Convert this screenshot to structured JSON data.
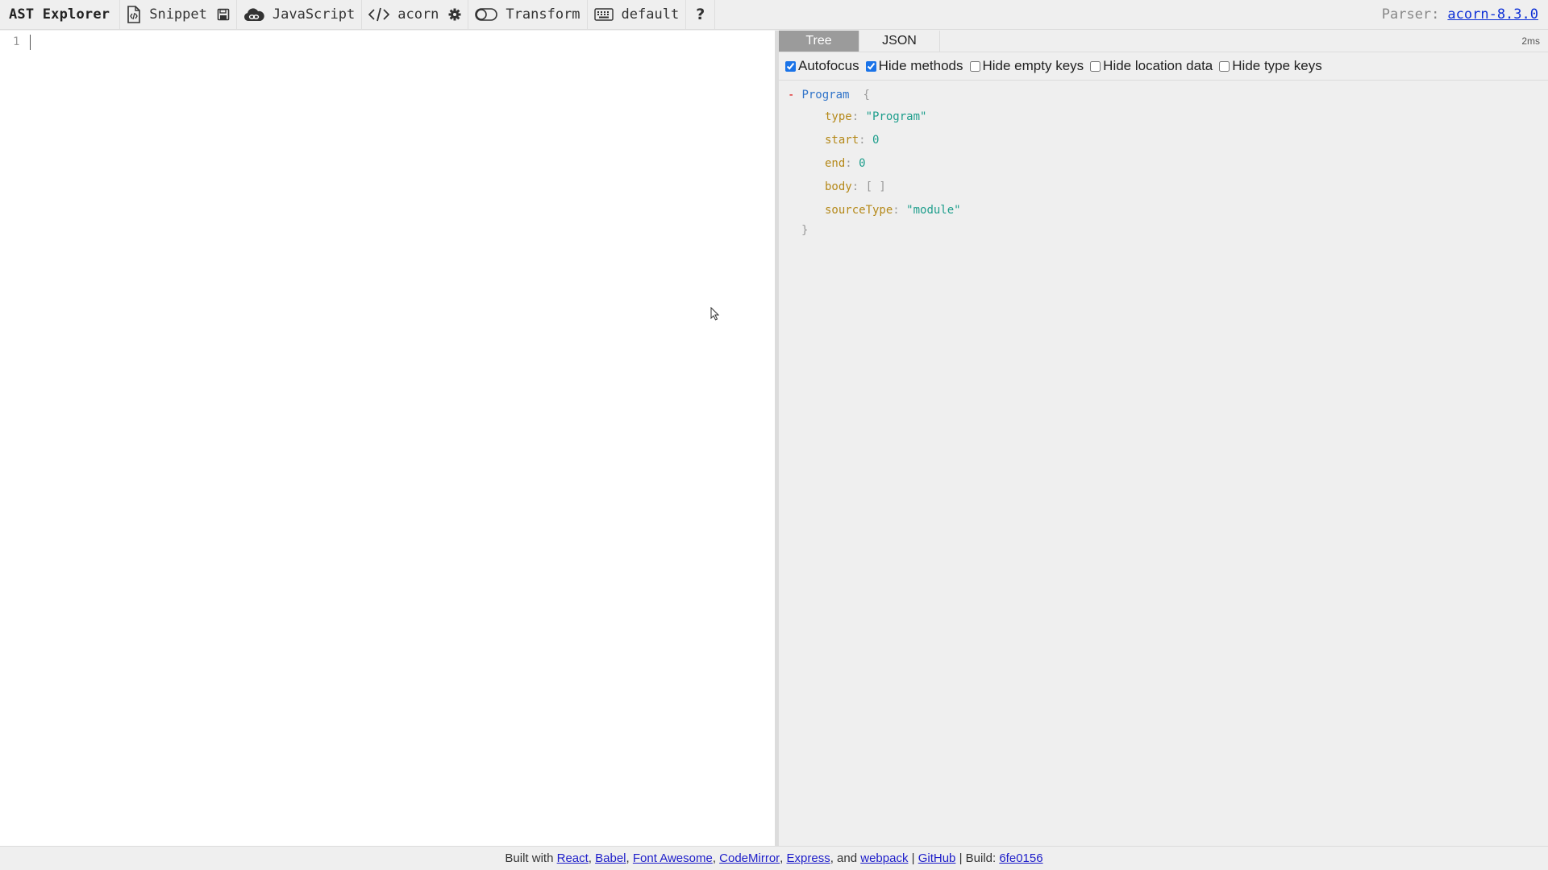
{
  "toolbar": {
    "brand": "AST Explorer",
    "snippet_label": "Snippet",
    "language_label": "JavaScript",
    "parser_name_label": "acorn",
    "transform_label": "Transform",
    "keymap_label": "default",
    "help_label": "?",
    "parser_prefix": "Parser:",
    "parser_version": "acorn-8.3.0",
    "icons": {
      "snippet": "file-code-icon",
      "save": "floppy-disk-icon",
      "language": "cloud-icon",
      "parser": "code-icon",
      "settings": "gear-icon",
      "transform": "toggle-off-icon",
      "keymap": "keyboard-icon",
      "help": "question-icon"
    }
  },
  "editor": {
    "line_numbers": [
      "1"
    ],
    "content": ""
  },
  "output": {
    "tabs": [
      {
        "label": "Tree",
        "active": true
      },
      {
        "label": "JSON",
        "active": false
      }
    ],
    "parse_time": "2ms",
    "options": [
      {
        "label": "Autofocus",
        "checked": true
      },
      {
        "label": "Hide methods",
        "checked": true
      },
      {
        "label": "Hide empty keys",
        "checked": false
      },
      {
        "label": "Hide location data",
        "checked": false
      },
      {
        "label": "Hide type keys",
        "checked": false
      }
    ],
    "tree": {
      "toggle": "-",
      "node_name": "Program",
      "open_brace": "{",
      "close_brace": "}",
      "properties": [
        {
          "key": "type",
          "value": "\"Program\"",
          "kind": "str"
        },
        {
          "key": "start",
          "value": "0",
          "kind": "num"
        },
        {
          "key": "end",
          "value": "0",
          "kind": "num"
        },
        {
          "key": "body",
          "value": "[ ]",
          "kind": "punct"
        },
        {
          "key": "sourceType",
          "value": "\"module\"",
          "kind": "str"
        }
      ]
    }
  },
  "footer": {
    "prefix": "Built with",
    "links": [
      "React",
      "Babel",
      "Font Awesome",
      "CodeMirror",
      "Express",
      "webpack",
      "GitHub",
      "6fe0156"
    ],
    "and_text": ", and",
    "build_label": "Build:",
    "separator": "|"
  }
}
